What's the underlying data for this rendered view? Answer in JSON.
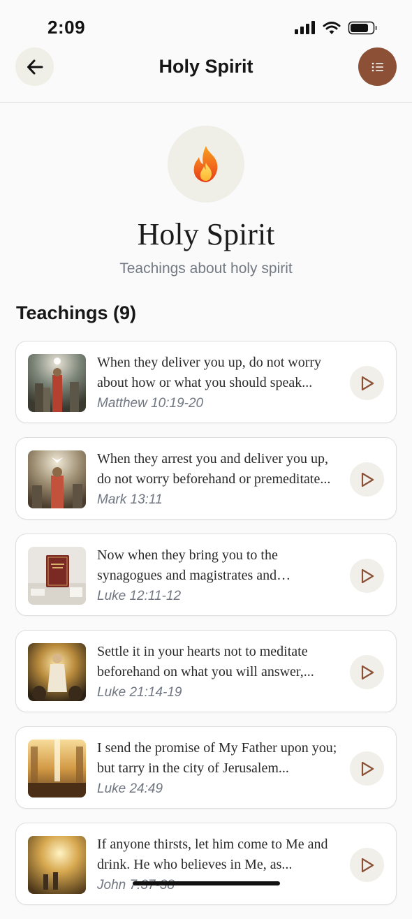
{
  "status_bar": {
    "time": "2:09"
  },
  "header": {
    "title": "Holy Spirit"
  },
  "hero": {
    "title": "Holy Spirit",
    "subtitle": "Teachings about holy spirit",
    "icon": "fire-icon"
  },
  "section": {
    "heading": "Teachings (9)"
  },
  "teachings": [
    {
      "text": "When they deliver you up, do not worry about how or what you should speak...",
      "ref": "Matthew 10:19-20"
    },
    {
      "text": "When they arrest you and deliver you up, do not worry beforehand or premeditate...",
      "ref": "Mark 13:11"
    },
    {
      "text": "Now when they bring you to the synagogues and magistrates and authorities...",
      "ref": "Luke 12:11-12"
    },
    {
      "text": "Settle it in your hearts not to meditate beforehand on what you will answer,...",
      "ref": "Luke 21:14-19"
    },
    {
      "text": "I send the promise of My Father upon you; but tarry in the city of Jerusalem...",
      "ref": "Luke 24:49"
    },
    {
      "text": "If anyone thirsts, let him come to Me and drink. He who believes in Me, as...",
      "ref": "John 7:37-38"
    }
  ],
  "colors": {
    "accent": "#8b5036",
    "play_icon": "#8b5036",
    "button_bg": "#efeee7"
  }
}
